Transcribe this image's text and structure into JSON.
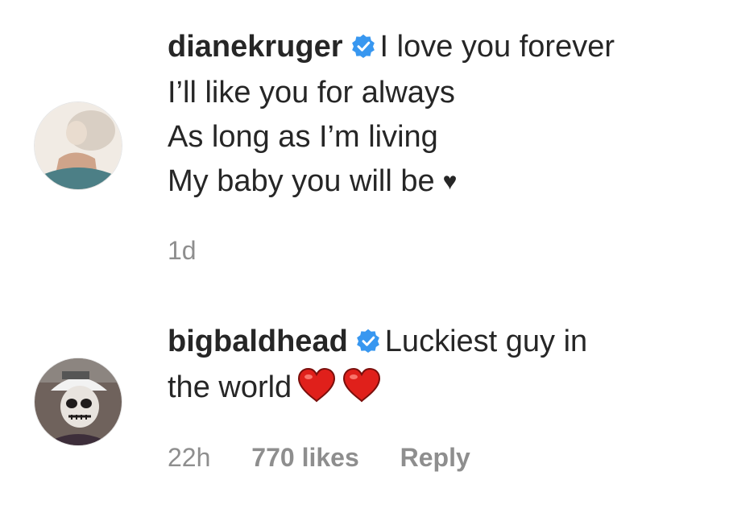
{
  "comments": [
    {
      "username": "dianekruger",
      "verified": true,
      "lines": [
        "I love you forever",
        "I’ll like you for always",
        "As long as I’m living",
        "My baby you will be"
      ],
      "trailing_emoji": "♥",
      "time": "1d"
    },
    {
      "username": "bigbaldhead",
      "verified": true,
      "lines": [
        "Luckiest guy in",
        "the world"
      ],
      "trailing_emoji": "❤️❤️",
      "time": "22h",
      "likes": "770 likes",
      "reply": "Reply"
    }
  ],
  "colors": {
    "text": "#262626",
    "meta": "#8e8e8e",
    "verified_badge": "#3897f0",
    "heart_red": "#e0201b"
  }
}
